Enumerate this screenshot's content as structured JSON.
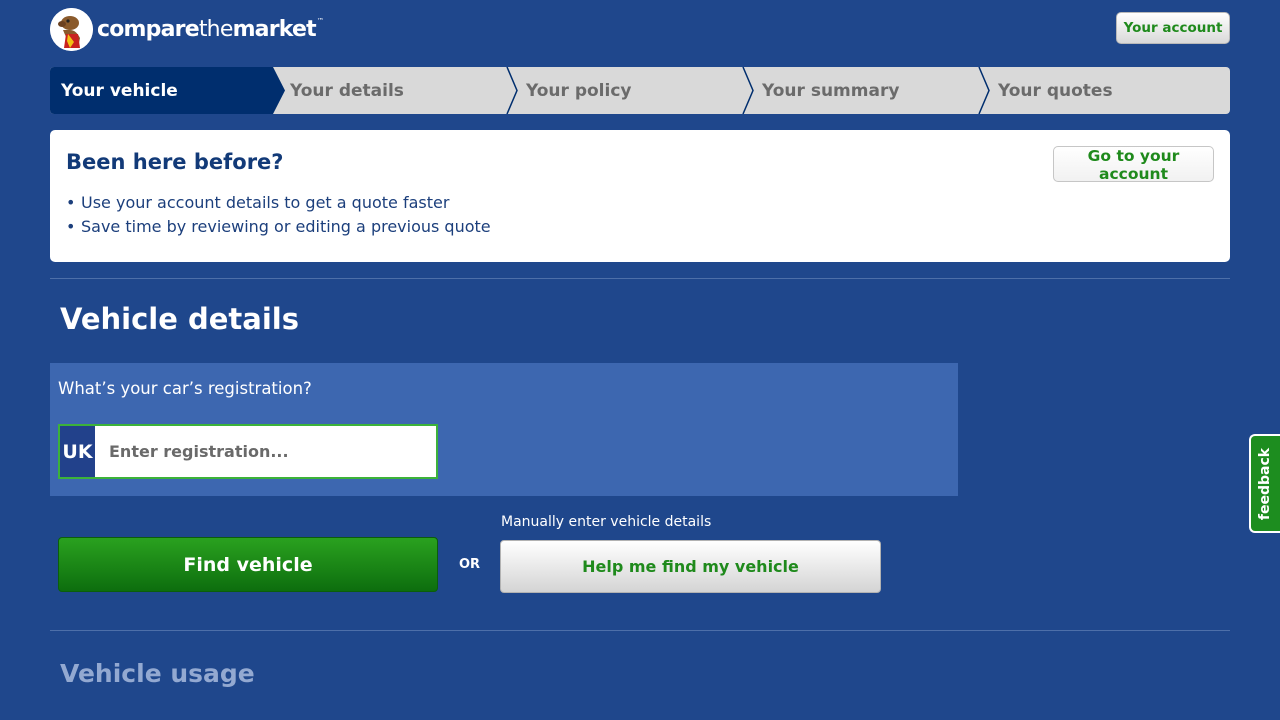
{
  "header": {
    "logo": {
      "text_bold_1": "compare",
      "text_thin": "the",
      "text_bold_2": "market",
      "tm": "™",
      "icon": "meerkat-icon"
    },
    "account_button": "Your account"
  },
  "steps": [
    {
      "label": "Your vehicle",
      "active": true
    },
    {
      "label": "Your details",
      "active": false
    },
    {
      "label": "Your policy",
      "active": false
    },
    {
      "label": "Your summary",
      "active": false
    },
    {
      "label": "Your quotes",
      "active": false
    }
  ],
  "returning": {
    "title": "Been here before?",
    "bullets": [
      "Use your account details to get a quote faster",
      "Save time by reviewing or editing a previous quote"
    ],
    "button": "Go to your account"
  },
  "vehicle": {
    "title": "Vehicle details",
    "reg_question": "What’s your car’s registration?",
    "uk_label": "UK",
    "reg_placeholder": "Enter registration...",
    "find_button": "Find vehicle",
    "or_label": "OR",
    "manual_label": "Manually enter vehicle details",
    "help_button": "Help me find my vehicle"
  },
  "usage": {
    "title": "Vehicle usage"
  },
  "feedback_tab": "feedback",
  "colors": {
    "background": "#1f478c",
    "active_step": "#002e6e",
    "green": "#1f8a1c",
    "reg_box": "#3d67b0"
  }
}
